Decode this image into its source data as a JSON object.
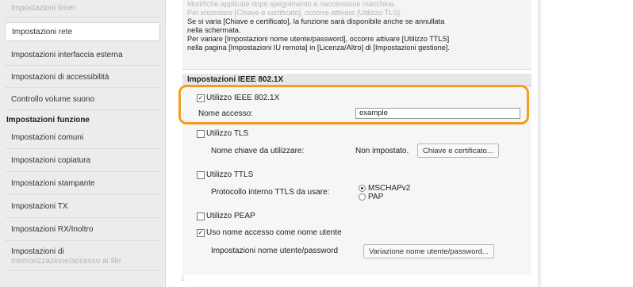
{
  "sidebar": {
    "items": [
      {
        "label": "Impostazioni timer",
        "faded": true
      },
      {
        "label": "Impostazioni rete",
        "selected": true
      },
      {
        "label": "Impostazioni interfaccia esterna"
      },
      {
        "label": "Impostazioni di accessibilità"
      },
      {
        "label": "Controllo volume suono"
      }
    ],
    "section_title": "Impostazioni funzione",
    "function_items": [
      {
        "label": "Impostazioni comuni"
      },
      {
        "label": "Impostazioni copiatura"
      },
      {
        "label": "Impostazioni stampante"
      },
      {
        "label": "Impostazioni TX"
      },
      {
        "label": "Impostazioni RX/Inoltro"
      }
    ],
    "last_item": {
      "line1": "Impostazioni di",
      "line2": "memorizzazione/accesso ai file"
    }
  },
  "info": {
    "lines": [
      "Modifiche applicate dopo spegnimento e riaccensione macchina.",
      "Per impostare [Chiave e certificato], occorre attivare [Utilizzo TLS].",
      "Se si varia [Chiave e certificato], la funzione sarà disponibile anche se annullata",
      "nella schermata.",
      "Per variare [Impostazioni nome utente/password], occorre attivare [Utilizzo TTLS]",
      "nella pagina [Impostazioni IU remota] in [Licenza/Altro] di [Impostazioni gestione]."
    ]
  },
  "section": {
    "title": "Impostazioni IEEE 802.1X"
  },
  "form": {
    "use_ieee": {
      "label": "Utilizzo IEEE 802.1X",
      "checked": true
    },
    "login_name": {
      "label": "Nome accesso:",
      "value": "example"
    },
    "use_tls": {
      "label": "Utilizzo TLS",
      "checked": false
    },
    "key_name": {
      "label": "Nome chiave da utilizzare:",
      "value": "Non impostato.",
      "button": "Chiave e certificato..."
    },
    "use_ttls": {
      "label": "Utilizzo TTLS",
      "checked": false
    },
    "ttls_protocol": {
      "label": "Protocollo interno TTLS da usare:",
      "options": [
        "MSCHAPv2",
        "PAP"
      ],
      "selected": "MSCHAPv2"
    },
    "use_peap": {
      "label": "Utilizzo PEAP",
      "checked": false
    },
    "use_login_as_user": {
      "label": "Uso nome accesso come nome utente",
      "checked": true
    },
    "user_pass": {
      "label": "Impostazioni nome utente/password",
      "button": "Variazione nome utente/password..."
    }
  },
  "footer": {
    "mark": "1"
  },
  "colors": {
    "highlight": "#f0a020"
  }
}
